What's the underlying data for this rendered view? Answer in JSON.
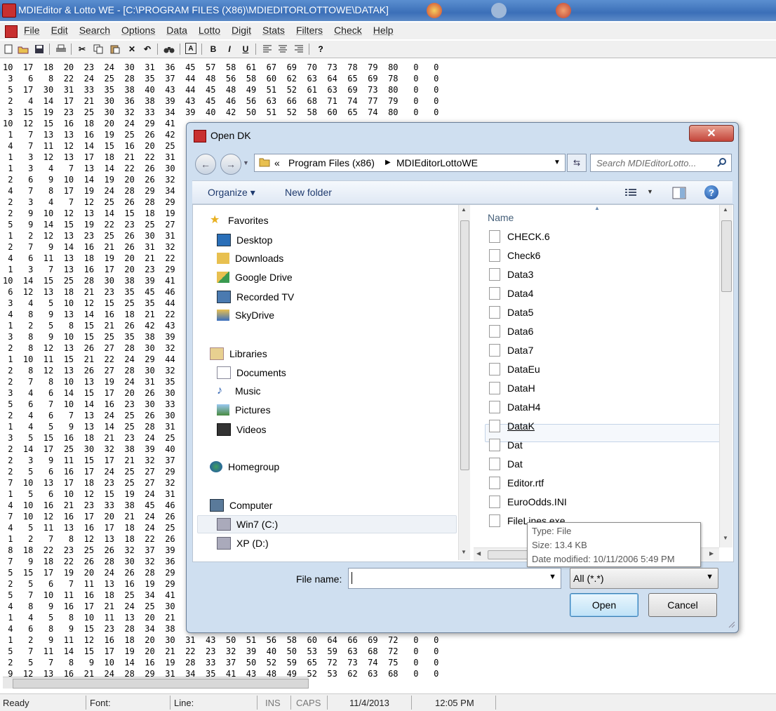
{
  "window": {
    "title": "MDIEditor & Lotto WE - [C:\\PROGRAM FILES (X86)\\MDIEDITORLOTTOWE\\DATAK]"
  },
  "menu": [
    "File",
    "Edit",
    "Search",
    "Options",
    "Data",
    "Lotto",
    "Digit",
    "Stats",
    "Filters",
    "Check",
    "Help"
  ],
  "toolbar_glyphs": {
    "bold": "B",
    "italic": "I",
    "underline": "U",
    "help": "?"
  },
  "editor_lines": [
    "10  17  18  20  23  24  30  31  36  45  57  58  61  67  69  70  73  78  79  80   0   0",
    " 3   6   8  22  24  25  28  35  37  44  48  56  58  60  62  63  64  65  69  78   0   0",
    " 5  17  30  31  33  35  38  40  43  44  45  48  49  51  52  61  63  69  73  80   0   0",
    " 2   4  14  17  21  30  36  38  39  43  45  46  56  63  66  68  71  74  77  79   0   0",
    " 3  15  19  23  25  30  32  33  34  39  40  42  50  51  52  58  60  65  74  80   0   0",
    "10  12  15  16  18  20  24  29  41",
    " 1   7  13  13  16  19  25  26  42",
    " 4   7  11  12  14  15  16  20  25",
    " 1   3  12  13  17  18  21  22  31",
    " 1   3   4   7  13  14  22  26  30",
    " 2   6   9  10  14  19  20  26  32",
    " 4   7   8  17  19  24  28  29  34",
    " 2   3   4   7  12  25  26  28  29",
    " 2   9  10  12  13  14  15  18  19",
    " 5   9  14  15  19  22  23  25  27",
    " 1   2  12  13  23  25  26  30  31",
    " 2   7   9  14  16  21  26  31  32",
    " 4   6  11  13  18  19  20  21  22",
    " 1   3   7  13  16  17  20  23  29",
    "10  14  15  25  28  30  38  39  41",
    " 6  12  13  18  21  23  35  45  46",
    " 3   4   5  10  12  15  25  35  44",
    " 4   8   9  13  14  16  18  21  22",
    " 1   2   5   8  15  21  26  42  43",
    " 3   8   9  10  15  25  35  38  39",
    " 2   8  12  13  26  27  28  30  32",
    " 1  10  11  15  21  22  24  29  44",
    " 2   8  12  13  26  27  28  30  32",
    " 2   7   8  10  13  19  24  31  35",
    " 3   4   6  14  15  17  20  26  30",
    " 5   6   7  10  14  16  23  30  33",
    " 2   4   6   7  13  24  25  26  30",
    " 1   4   5   9  13  14  25  28  31",
    " 3   5  15  16  18  21  23  24  25",
    " 2  14  17  25  30  32  38  39  40",
    " 2   3   9  11  15  17  21  32  37",
    " 2   5   6  16  17  24  25  27  29",
    " 7  10  13  17  18  23  25  27  32",
    " 1   5   6  10  12  15  19  24  31",
    " 4  10  16  21  23  33  38  45  46",
    " 7  10  12  16  17  20  21  24  26",
    " 4   5  11  13  16  17  18  24  25",
    " 1   2   7   8  12  13  18  22  26",
    " 8  18  22  23  25  26  32  37  39",
    " 7   9  18  22  26  28  30  32  36",
    " 5  15  17  19  20  24  26  28  29",
    " 2   5   6   7  11  13  16  19  29",
    " 5   7  10  11  16  18  25  34  41",
    " 4   8   9  16  17  21  24  25  30",
    " 1   4   5   8  10  11  13  20  21",
    " 4   6   8   9  15  23  28  34  38",
    " 1   2   9  11  12  16  18  20  30  31  43  50  51  56  58  60  64  66  69  72   0   0",
    " 5   7  11  14  15  17  19  20  21  22  23  32  39  40  50  53  59  63  68  72   0   0",
    " 2   5   7   8   9  10  14  16  19  28  33  37  50  52  59  65  72  73  74  75   0   0",
    " 9  12  13  16  21  24  28  29  31  34  35  41  43  48  49  52  53  62  63  68   0   0"
  ],
  "status": {
    "ready": "Ready",
    "font": "Font:",
    "line": "Line:",
    "ins": "INS",
    "caps": "CAPS",
    "date": "11/4/2013",
    "time": "12:05 PM"
  },
  "dialog": {
    "title": "Open DK",
    "close_glyph": "✕",
    "address": {
      "chevron": "«",
      "seg1": "Program Files (x86)",
      "seg2": "MDIEditorLottoWE"
    },
    "search_placeholder": "Search MDIEditorLotto...",
    "organize": "Organize ▾",
    "new_folder": "New folder",
    "nav": {
      "favorites": "Favorites",
      "desktop": "Desktop",
      "downloads": "Downloads",
      "google_drive": "Google Drive",
      "recorded_tv": "Recorded TV",
      "skydrive": "SkyDrive",
      "libraries": "Libraries",
      "documents": "Documents",
      "music": "Music",
      "pictures": "Pictures",
      "videos": "Videos",
      "homegroup": "Homegroup",
      "computer": "Computer",
      "win7": "Win7 (C:)",
      "xp": "XP (D:)"
    },
    "column_name": "Name",
    "files": [
      "CHECK.6",
      "Check6",
      "Data3",
      "Data4",
      "Data5",
      "Data6",
      "Data7",
      "DataEu",
      "DataH",
      "DataH4",
      "DataK",
      "Dat",
      "Dat",
      "Editor.rtf",
      "EuroOdds.INI",
      "FileLines.exe"
    ],
    "tooltip": {
      "type": "Type: File",
      "size": "Size: 13.4 KB",
      "modified": "Date modified: 10/11/2006 5:49 PM"
    },
    "file_name_label": "File name:",
    "file_name_value": "",
    "filter_value": "All (*.*)",
    "open_label": "Open",
    "cancel_label": "Cancel"
  }
}
